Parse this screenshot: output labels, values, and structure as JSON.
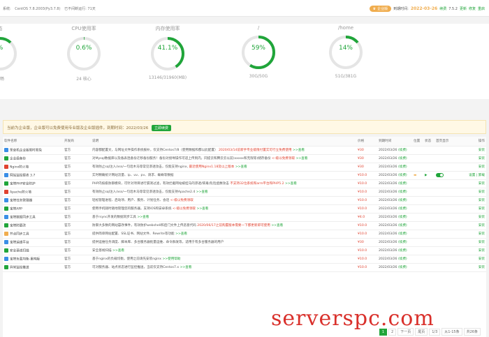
{
  "header": {
    "system_label": "系统:",
    "system_value": "CentOS 7.8.2003(Py3.7.8)",
    "uptime": "已不间断运行: 71天",
    "edition_badge": "企业版",
    "expire_label": "到期时间:",
    "expire_date": "2022-03-26",
    "renew": "续费",
    "version": "7.5.2",
    "update": "更新",
    "fix": "修复",
    "restart": "重启"
  },
  "stats": [
    {
      "title": "态",
      "value": "%",
      "sub": "流畅",
      "percent": 0.12,
      "color": "#20a53a"
    },
    {
      "title": "CPU使用率",
      "value": "0.6%",
      "sub": "24 核心",
      "percent": 0.006,
      "color": "#20a53a"
    },
    {
      "title": "内存使用率",
      "value": "41.1%",
      "sub": "13146/31960(MB)",
      "percent": 0.411,
      "color": "#20a53a"
    },
    {
      "title": "/",
      "value": "59%",
      "sub": "30G/50G",
      "percent": 0.59,
      "color": "#20a53a"
    },
    {
      "title": "/home",
      "value": "14%",
      "sub": "51G/381G",
      "percent": 0.14,
      "color": "#20a53a"
    }
  ],
  "notice": {
    "text": "当前为企业版，企业版可以免费使用专业版及企业版插件，到期时间：2022/03/26",
    "button": "立即续费"
  },
  "table": {
    "headers": [
      "软件名称",
      "开发商",
      "说明",
      "价格",
      "到期时间",
      "位置",
      "状态",
      "首页显示",
      "操作"
    ],
    "rows": [
      {
        "name": "堡垒机企业版限时限免",
        "dev": "官方",
        "desc": "内容都配置文，与网址文件操作系统报补，仅支持Centos7/8（使用数据和都以此配置）",
        "desc_red": "2020/03/14前新手专业级限付置实可行立免费使用",
        "desc_green": ">>查看",
        "price": "¥30",
        "expire": "2022/03/26",
        "renew": "(续费)",
        "op": "安装",
        "icon": "#3a8ee6"
      },
      {
        "name": "企业级备份",
        "dev": "官方",
        "desc": "对Mysql数据库以及备表连备份迁移备份服务！备份对接导操作可适上传到内，同提云和腾云云以前(xxxxx和无限等)储存备份",
        "desc_red": "<-级以免费领取",
        "desc_green": ">>查看",
        "price": "¥30",
        "expire": "2022/03/26",
        "renew": "(续费)",
        "op": "安装",
        "icon": "#20a53a"
      },
      {
        "name": "Nginx防火墙",
        "dev": "官方",
        "desc": "有效防止sql注入/xss/一句话木马等常见渗透攻击，仅能支持nginx,",
        "desc_red": "最近使用Nginx1.18及以上版本",
        "desc_green": ">>查看",
        "price": "¥30",
        "expire": "2022/03/26",
        "renew": "(续费)",
        "op": "安装",
        "icon": "#e0422f"
      },
      {
        "name": "网站监控报表 3.7",
        "dev": "官方",
        "desc": "实时精确统计网站流量、ip、uv、pv、请求、蜘蛛等数据",
        "desc_red": "",
        "desc_green": "",
        "price": "¥10.0",
        "expire": "2022/03/26",
        "renew": "(续费)",
        "op": "设置 | 卸载",
        "icon": "#3a8ee6",
        "installed": true
      },
      {
        "name": "宝塔PHP安全防护",
        "dev": "官方",
        "desc": "PHP内核级防御模块，可针对项目进行漏洞过滤，有效拦截网站被挂马的渗透/病毒/危险函数攻击",
        "desc_red": "不支持32位系统和arm平台和PHP5.2",
        "desc_green": ">>查看",
        "price": "¥10.0",
        "expire": "2022/03/26",
        "renew": "(续费)",
        "op": "安装",
        "icon": "#20a53a"
      },
      {
        "name": "Apache防火墙",
        "dev": "官方",
        "desc": "有效防止sql注入/xss/一句话木马等常见渗透攻击，仅能支持Apache2.4",
        "desc_red": "",
        "desc_green": ">>查看",
        "price": "¥10.0",
        "expire": "2022/03/26",
        "renew": "(续费)",
        "op": "安装",
        "icon": "#e0422f"
      },
      {
        "name": "宝塔任务管理器",
        "dev": "官方",
        "desc": "轻松管理进程、启动项、用户、服务、计划任务、会话",
        "desc_red": "<-级以免费领取",
        "desc_green": "",
        "price": "¥10.0",
        "expire": "2022/03/26",
        "renew": "(续费)",
        "op": "安装",
        "icon": "#3a8ee6"
      },
      {
        "name": "宝塔APP",
        "dev": "官方",
        "desc": "使用手机随时随地管理您的服务器，支持iOS和安卓系统",
        "desc_red": "<-级以免费领取",
        "desc_green": ">>查看",
        "price": "¥10.0",
        "expire": "2022/03/26",
        "renew": "(续费)",
        "op": "安装",
        "icon": "#20a53a"
      },
      {
        "name": "宝塔数据同步工具",
        "dev": "官方",
        "desc": "基于rsync开发的数据同步工具",
        "desc_red": "",
        "desc_green": ">>查看",
        "price": "¥4.0",
        "expire": "2022/03/26",
        "renew": "(续费)",
        "op": "安装",
        "icon": "#3a8ee6"
      },
      {
        "name": "宝塔防篡改",
        "dev": "官方",
        "desc": "防御大多数的网站篡改事件，有效防护webshell和后门文件上传恶意代码",
        "desc_red": "2020/06/17之前购置版本需要一下都更新即可使用",
        "desc_green": ">>查看",
        "price": "¥10.0",
        "expire": "2022/03/26",
        "renew": "(续费)",
        "op": "安装",
        "icon": "#20a53a"
      },
      {
        "name": "节点同步工具",
        "dev": "官方",
        "desc": "提供简单网站配置、SSL证书、网站文件、Rewrite等功能",
        "desc_red": "",
        "desc_green": ">>查看",
        "price": "¥10.0",
        "expire": "2022/03/26",
        "renew": "(续费)",
        "op": "安装",
        "icon": "#f0ad4e"
      },
      {
        "name": "宝塔运维平台",
        "dev": "官方",
        "desc": "提供运维任务调度、脚本库、多台服务器批量运维、命令群发等，适用于有多台服务器的用户",
        "desc_red": "",
        "desc_green": "",
        "price": "¥30",
        "expire": "2022/03/26",
        "renew": "(续费)",
        "op": "安装",
        "icon": "#3a8ee6"
      },
      {
        "name": "安全基线扫描",
        "dev": "官方",
        "desc": "安全基线扫描",
        "desc_red": "",
        "desc_green": ">>查看",
        "price": "¥10.0",
        "expire": "2022/03/26",
        "renew": "(续费)",
        "op": "安装",
        "icon": "#20a53a"
      },
      {
        "name": "宝塔负载均衡-重构版",
        "dev": "官方",
        "desc": "基于nginx的负载均衡，使用之前请先安装nginx",
        "desc_red": "",
        "desc_green": ">>使用帮助",
        "price": "¥10.0",
        "expire": "2022/03/26",
        "renew": "(续费)",
        "op": "安装",
        "icon": "#3a8ee6"
      },
      {
        "name": "异常监控推送",
        "dev": "官方",
        "desc": "可对服务器、站点状态进行监控推送，当前仅支持Centos7.x",
        "desc_red": "",
        "desc_green": ">>查看",
        "price": "¥10.0",
        "expire": "2022/03/26",
        "renew": "(续费)",
        "op": "安装",
        "icon": "#20a53a"
      }
    ]
  },
  "pager": {
    "pages": [
      "1",
      "2",
      "下一页",
      "尾页",
      "1/3",
      "从1-15条",
      "共26条"
    ]
  },
  "watermark": "serverspc.com"
}
